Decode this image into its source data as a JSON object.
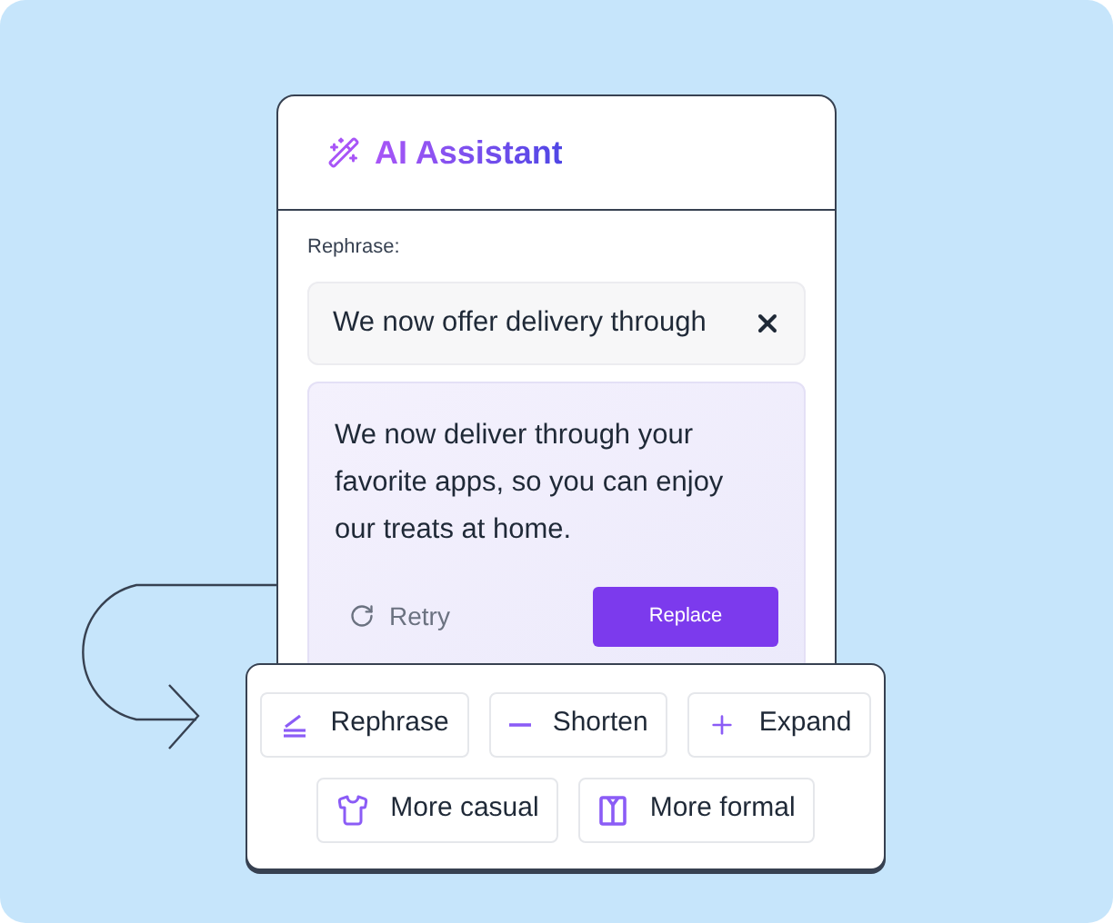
{
  "panel": {
    "title": "AI Assistant",
    "section_label": "Rephrase:",
    "input": {
      "value": "We now offer delivery through"
    },
    "suggestion": {
      "text": "We now deliver through your favorite apps, so you can enjoy our treats at home.",
      "retry": "Retry",
      "replace": "Replace"
    }
  },
  "actions": [
    [
      {
        "kind": "rephrase",
        "label": "Rephrase"
      },
      {
        "kind": "shorten",
        "label": "Shorten"
      },
      {
        "kind": "expand",
        "label": "Expand"
      }
    ],
    [
      {
        "kind": "casual",
        "label": "More casual"
      },
      {
        "kind": "formal",
        "label": "More formal"
      }
    ]
  ]
}
